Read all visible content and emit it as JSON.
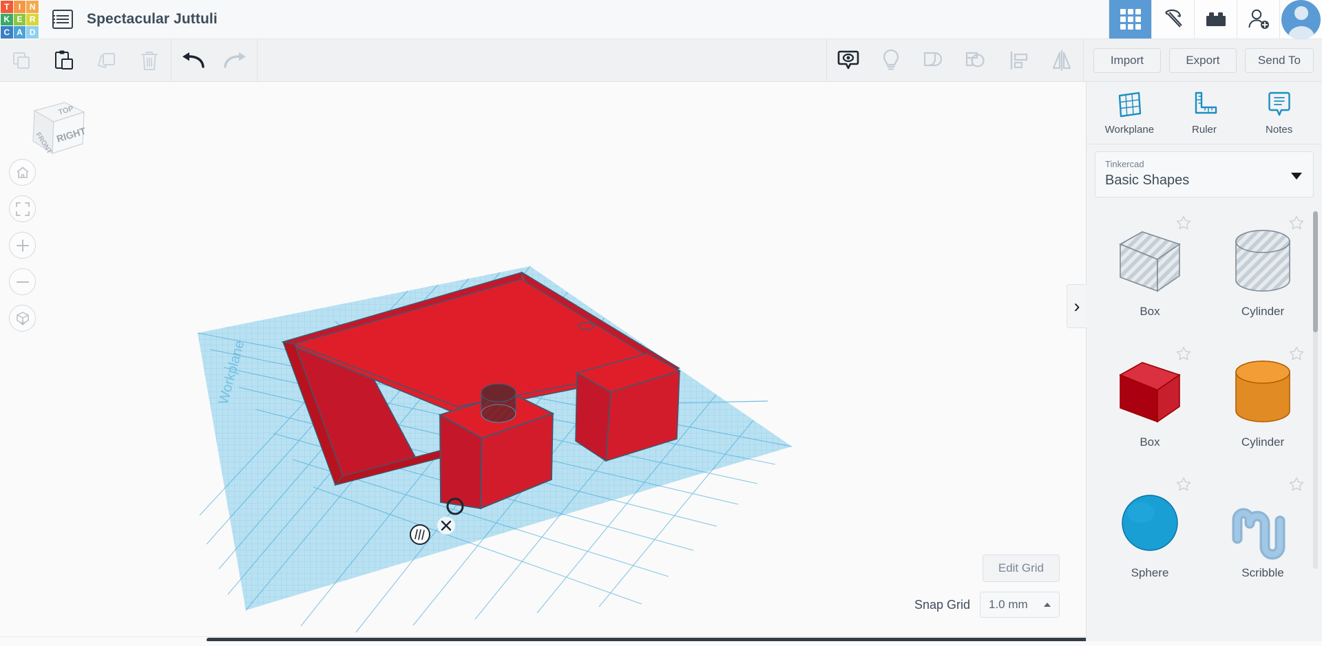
{
  "app": {
    "title": "Spectacular Juttuli",
    "logo_letters": [
      "T",
      "I",
      "N",
      "K",
      "E",
      "R",
      "C",
      "A",
      "D"
    ],
    "logo_colors": [
      "#f05b35",
      "#f79646",
      "#f5a94e",
      "#3aa96a",
      "#8dc63f",
      "#d8d63c",
      "#3b7fc4",
      "#4ba3d6",
      "#8fd0ef"
    ]
  },
  "topbar": {
    "doc_icon": "document-list-icon",
    "icons": [
      {
        "name": "grid-apps-icon",
        "active": true
      },
      {
        "name": "pickaxe-minecraft-icon",
        "active": false
      },
      {
        "name": "lego-brick-icon",
        "active": false
      },
      {
        "name": "add-user-icon",
        "active": false
      }
    ],
    "avatar": "user-avatar"
  },
  "toolbar": {
    "left_tools": [
      {
        "name": "copy-icon",
        "label": "Copy",
        "enabled": false
      },
      {
        "name": "paste-icon",
        "label": "Paste",
        "enabled": true
      },
      {
        "name": "duplicate-icon",
        "label": "Duplicate",
        "enabled": false
      },
      {
        "name": "delete-icon",
        "label": "Delete",
        "enabled": false
      }
    ],
    "history_tools": [
      {
        "name": "undo-icon",
        "label": "Undo",
        "enabled": true
      },
      {
        "name": "redo-icon",
        "label": "Redo",
        "enabled": false
      }
    ],
    "view_tools": [
      {
        "name": "show-hide-eye-icon",
        "label": "Show / Hide",
        "enabled": true
      },
      {
        "name": "lightbulb-icon",
        "label": "Light",
        "enabled": false
      },
      {
        "name": "group-icon",
        "label": "Group",
        "enabled": false
      },
      {
        "name": "ungroup-icon",
        "label": "Ungroup",
        "enabled": false
      },
      {
        "name": "align-icon",
        "label": "Align",
        "enabled": false
      },
      {
        "name": "mirror-icon",
        "label": "Mirror",
        "enabled": false
      }
    ],
    "import_label": "Import",
    "export_label": "Export",
    "send_to_label": "Send To"
  },
  "canvas": {
    "viewcube_faces": {
      "top": "TOP",
      "front": "FRONT",
      "right": "RIGHT"
    },
    "workplane_label": "Workplane",
    "nav_buttons": [
      {
        "name": "home-view-button",
        "label": "Home View"
      },
      {
        "name": "fit-to-view-button",
        "label": "Fit All In View"
      },
      {
        "name": "zoom-in-button",
        "label": "Zoom In"
      },
      {
        "name": "zoom-out-button",
        "label": "Zoom Out"
      },
      {
        "name": "ortho-perspective-toggle",
        "label": "Switch To Orthographic View"
      }
    ],
    "model_colors": {
      "solid_red": "#e01e2a",
      "red_dark": "#b8121e",
      "red_top": "#e11f2c",
      "edge": "#3b5a72",
      "grid_blue": "#aadcf0",
      "grid_line": "#3fa7d6",
      "hole_dark": "#5e2127"
    },
    "markers": [
      {
        "name": "rotation-handle-marker",
        "glyph": "○"
      },
      {
        "name": "delete-x-marker",
        "glyph": "×"
      },
      {
        "name": "hatched-circle-marker",
        "glyph": "|||"
      }
    ]
  },
  "grid_controls": {
    "edit_grid_label": "Edit Grid",
    "snap_grid_label": "Snap Grid",
    "snap_grid_value": "1.0 mm"
  },
  "right_panel": {
    "tools": [
      {
        "name": "workplane-tool",
        "label": "Workplane",
        "icon": "workplane-grid-icon"
      },
      {
        "name": "ruler-tool",
        "label": "Ruler",
        "icon": "ruler-icon"
      },
      {
        "name": "notes-tool",
        "label": "Notes",
        "icon": "notes-bubble-icon"
      }
    ],
    "library_source": "Tinkercad",
    "library_name": "Basic Shapes",
    "collapse_glyph": "›",
    "shapes": [
      {
        "name": "Box",
        "style": "hole",
        "geometry": "cube",
        "color": "#b9c2ca",
        "favorite": false
      },
      {
        "name": "Cylinder",
        "style": "hole",
        "geometry": "cylinder",
        "color": "#b9c2ca",
        "favorite": false
      },
      {
        "name": "Box",
        "style": "solid",
        "geometry": "cube",
        "color": "#c81e2d",
        "favorite": false
      },
      {
        "name": "Cylinder",
        "style": "solid",
        "geometry": "cylinder",
        "color": "#e08b24",
        "favorite": false
      },
      {
        "name": "Sphere",
        "style": "solid",
        "geometry": "sphere",
        "color": "#1a9fd4",
        "favorite": false
      },
      {
        "name": "Scribble",
        "style": "solid",
        "geometry": "scribble",
        "color": "#8fb6d4",
        "favorite": false
      }
    ]
  }
}
